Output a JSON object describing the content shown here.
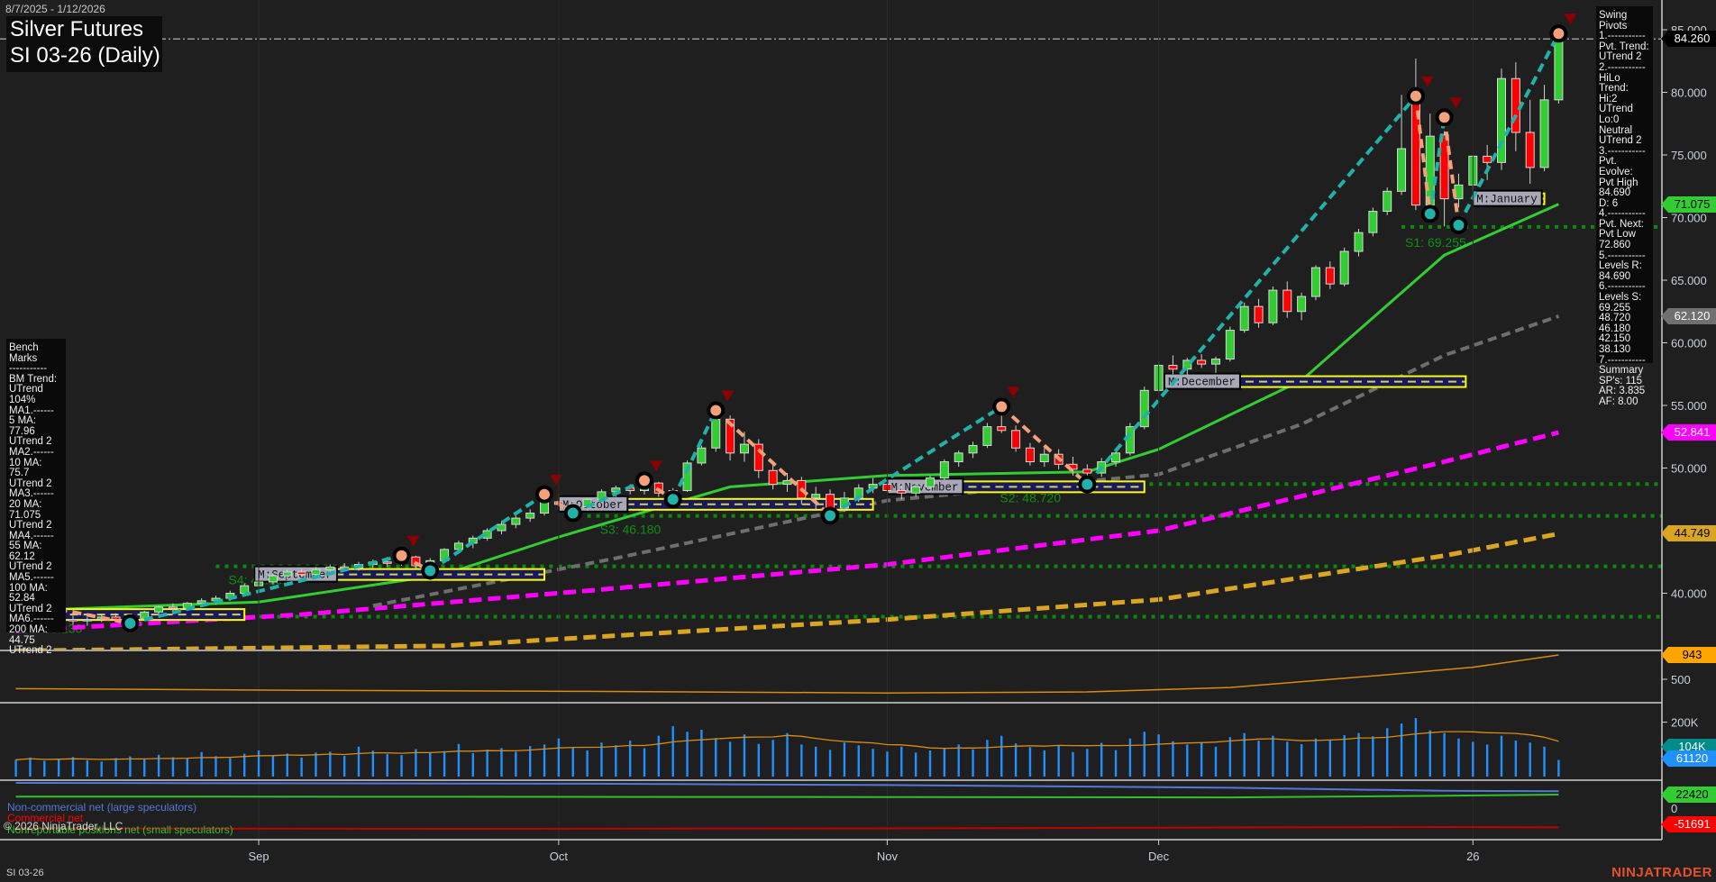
{
  "header": {
    "date_range": "8/7/2025 - 1/12/2026",
    "title_line1": "Silver Futures",
    "title_line2": "SI 03-26 (Daily)"
  },
  "swing_pivots": {
    "lines": [
      "Swing Pivots",
      "1.-----------",
      "Pvt. Trend:",
      "UTrend 2",
      "2.-----------",
      "HiLo Trend:",
      "Hi:2 UTrend",
      "Lo:0 Neutral",
      "UTrend 2",
      "3.-----------",
      "Pvt. Evolve:",
      "Pvt High",
      "84.690",
      "D: 6",
      "4.-----------",
      "Pvt. Next:",
      "Pvt Low",
      "72.860",
      "5.-----------",
      "Levels R:",
      "84.690",
      "6.-----------",
      "Levels S:",
      "69.255",
      "48.720",
      "46.180",
      "42.150",
      "38.130",
      "7.-----------",
      "Summary",
      "SP's: 115",
      "AR: 3.835",
      "AF: 8.00"
    ]
  },
  "bench_marks": {
    "lines": [
      "Bench Marks",
      "-----------",
      "BM Trend:",
      "UTrend 104%",
      "MA1.------",
      "5 MA:",
      "77.96",
      "UTrend 2",
      "MA2.------",
      "10 MA:",
      "75.7",
      "UTrend 2",
      "MA3.------",
      "20 MA:",
      "71.075",
      "UTrend 2",
      "MA4.------",
      "55 MA:",
      "62.12",
      "UTrend 2",
      "MA5.------",
      "100 MA:",
      "52.84",
      "UTrend 2",
      "MA6.------",
      "200 MA:",
      "44.75",
      "UTrend 2"
    ]
  },
  "legend": {
    "noncommercial": "Non-commercial net (large speculators)",
    "commercial": "Commercial net",
    "copyright": "© 2026 NinjaTrader, LLC",
    "nonreportable": "Nonreportable positions net (small speculators)"
  },
  "footer": {
    "symbol": "SI 03-26",
    "brand": "NINJATRADER"
  },
  "price_tags": [
    {
      "label": "84.260",
      "value": 84.26,
      "bg": "#000000",
      "fg": "#ffffff"
    },
    {
      "label": "71.075",
      "value": 71.075,
      "bg": "#32cd32",
      "fg": "#000000"
    },
    {
      "label": "62.120",
      "value": 62.12,
      "bg": "#707070",
      "fg": "#ffffff"
    },
    {
      "label": "52.841",
      "value": 52.841,
      "bg": "#ff00ff",
      "fg": "#ffffff"
    },
    {
      "label": "44.749",
      "value": 44.749,
      "bg": "#daa520",
      "fg": "#000000"
    }
  ],
  "colors": {
    "up": "#32cd32",
    "down": "#ff0000",
    "swing_up": "#20b2aa",
    "swing_down": "#f4a07a",
    "level": "#0a8a0a",
    "bg": "#1f1f1f"
  },
  "chart_data": {
    "type": "candlestick",
    "title": "Silver Futures SI 03-26 (Daily)",
    "ylim": [
      35.6,
      87.4
    ],
    "y_ticks": [
      "85.000",
      "80.000",
      "75.000",
      "70.000",
      "65.000",
      "60.000",
      "55.000",
      "50.000",
      "40.000"
    ],
    "x_ticks": [
      {
        "label": "Sep",
        "bar": 17
      },
      {
        "label": "Oct",
        "bar": 38
      },
      {
        "label": "Nov",
        "bar": 61
      },
      {
        "label": "Dec",
        "bar": 80
      },
      {
        "label": "26",
        "bar": 102
      }
    ],
    "ohlc": [
      [
        37.8,
        38.4,
        37.5,
        38.2
      ],
      [
        38.2,
        38.6,
        37.9,
        38.3
      ],
      [
        38.3,
        38.5,
        37.8,
        38.0
      ],
      [
        38.0,
        38.3,
        37.6,
        37.9
      ],
      [
        37.9,
        38.2,
        37.5,
        37.8
      ],
      [
        37.8,
        38.1,
        37.4,
        37.9
      ],
      [
        37.9,
        38.3,
        37.7,
        38.1
      ],
      [
        38.1,
        38.4,
        37.8,
        37.9
      ],
      [
        37.9,
        38.2,
        37.6,
        38.0
      ],
      [
        38.0,
        38.6,
        37.9,
        38.5
      ],
      [
        38.5,
        39.0,
        38.3,
        38.9
      ],
      [
        38.9,
        39.2,
        38.6,
        38.8
      ],
      [
        38.8,
        39.3,
        38.7,
        39.2
      ],
      [
        39.2,
        39.6,
        39.0,
        39.4
      ],
      [
        39.4,
        39.8,
        39.1,
        39.6
      ],
      [
        39.6,
        40.2,
        39.4,
        40.0
      ],
      [
        40.0,
        40.8,
        39.8,
        40.6
      ],
      [
        40.6,
        41.0,
        40.3,
        40.9
      ],
      [
        40.9,
        41.6,
        40.7,
        41.4
      ],
      [
        41.4,
        41.9,
        41.1,
        41.7
      ],
      [
        41.7,
        42.0,
        41.3,
        41.5
      ],
      [
        41.5,
        42.1,
        41.3,
        41.9
      ],
      [
        41.9,
        42.3,
        41.6,
        42.1
      ],
      [
        42.1,
        42.4,
        41.8,
        42.0
      ],
      [
        42.0,
        42.5,
        41.8,
        42.3
      ],
      [
        42.3,
        42.7,
        42.0,
        42.5
      ],
      [
        42.5,
        42.9,
        42.1,
        42.4
      ],
      [
        42.4,
        43.1,
        42.2,
        42.9
      ],
      [
        42.9,
        43.0,
        41.9,
        42.2
      ],
      [
        42.2,
        42.8,
        41.8,
        42.6
      ],
      [
        42.6,
        43.6,
        42.5,
        43.5
      ],
      [
        43.5,
        44.2,
        43.3,
        44.0
      ],
      [
        44.0,
        44.6,
        43.6,
        44.4
      ],
      [
        44.4,
        45.2,
        44.2,
        45.0
      ],
      [
        45.0,
        45.8,
        44.7,
        45.5
      ],
      [
        45.5,
        46.2,
        45.2,
        46.0
      ],
      [
        46.0,
        46.7,
        45.7,
        46.4
      ],
      [
        46.4,
        47.7,
        46.2,
        47.3
      ],
      [
        47.3,
        47.9,
        46.9,
        47.1
      ],
      [
        47.1,
        47.4,
        46.4,
        46.9
      ],
      [
        46.9,
        47.6,
        46.6,
        47.5
      ],
      [
        47.5,
        48.3,
        47.2,
        48.1
      ],
      [
        48.1,
        48.6,
        47.7,
        48.4
      ],
      [
        48.4,
        48.7,
        47.9,
        48.2
      ],
      [
        48.2,
        49.0,
        47.9,
        48.8
      ],
      [
        48.8,
        48.9,
        47.7,
        48.0
      ],
      [
        48.0,
        48.4,
        47.5,
        48.2
      ],
      [
        48.2,
        50.6,
        48.1,
        50.4
      ],
      [
        50.4,
        51.8,
        50.2,
        51.6
      ],
      [
        51.6,
        54.6,
        51.3,
        53.9
      ],
      [
        53.9,
        54.2,
        50.6,
        51.2
      ],
      [
        51.2,
        52.9,
        50.5,
        51.9
      ],
      [
        51.9,
        52.3,
        49.2,
        49.8
      ],
      [
        49.8,
        50.5,
        48.3,
        48.7
      ],
      [
        48.7,
        49.6,
        48.1,
        49.0
      ],
      [
        49.0,
        49.3,
        47.1,
        47.6
      ],
      [
        47.6,
        48.5,
        46.6,
        47.9
      ],
      [
        47.9,
        48.3,
        46.2,
        46.8
      ],
      [
        46.8,
        48.1,
        46.5,
        47.6
      ],
      [
        47.6,
        48.7,
        47.3,
        48.4
      ],
      [
        48.4,
        49.2,
        48.0,
        48.7
      ],
      [
        48.7,
        49.0,
        47.9,
        48.2
      ],
      [
        48.2,
        48.6,
        47.5,
        48.0
      ],
      [
        48.0,
        48.7,
        47.7,
        48.5
      ],
      [
        48.5,
        49.4,
        48.3,
        49.2
      ],
      [
        49.2,
        50.7,
        49.0,
        50.5
      ],
      [
        50.5,
        51.4,
        50.1,
        51.2
      ],
      [
        51.2,
        52.1,
        50.8,
        51.8
      ],
      [
        51.8,
        53.6,
        51.6,
        53.3
      ],
      [
        53.3,
        54.9,
        52.8,
        53.0
      ],
      [
        53.0,
        53.4,
        51.3,
        51.6
      ],
      [
        51.6,
        52.0,
        50.2,
        50.5
      ],
      [
        50.5,
        51.6,
        50.1,
        51.1
      ],
      [
        51.1,
        51.5,
        49.9,
        50.3
      ],
      [
        50.3,
        50.9,
        49.4,
        49.9
      ],
      [
        49.9,
        50.3,
        48.7,
        49.6
      ],
      [
        49.6,
        50.8,
        49.3,
        50.5
      ],
      [
        50.5,
        51.4,
        50.1,
        51.2
      ],
      [
        51.2,
        53.6,
        51.0,
        53.3
      ],
      [
        53.3,
        56.5,
        53.1,
        56.2
      ],
      [
        56.2,
        58.5,
        56.0,
        58.2
      ],
      [
        58.2,
        59.0,
        57.5,
        57.9
      ],
      [
        57.9,
        58.8,
        57.4,
        58.6
      ],
      [
        58.6,
        59.1,
        58.0,
        58.3
      ],
      [
        58.3,
        58.9,
        57.6,
        58.7
      ],
      [
        58.7,
        61.3,
        58.5,
        61.0
      ],
      [
        61.0,
        63.2,
        60.8,
        62.9
      ],
      [
        62.9,
        63.5,
        61.2,
        61.6
      ],
      [
        61.6,
        64.5,
        61.4,
        64.2
      ],
      [
        64.2,
        64.9,
        62.0,
        62.5
      ],
      [
        62.5,
        64.0,
        61.8,
        63.7
      ],
      [
        63.7,
        66.2,
        63.4,
        66.0
      ],
      [
        66.0,
        66.5,
        64.3,
        64.7
      ],
      [
        64.7,
        67.6,
        64.5,
        67.3
      ],
      [
        67.3,
        69.1,
        66.9,
        68.8
      ],
      [
        68.8,
        70.8,
        68.5,
        70.5
      ],
      [
        70.5,
        72.4,
        70.2,
        72.1
      ],
      [
        72.1,
        79.8,
        71.8,
        75.5
      ],
      [
        79.5,
        82.7,
        70.6,
        71.0
      ],
      [
        71.0,
        78.3,
        70.6,
        76.5
      ],
      [
        76.6,
        76.9,
        69.3,
        71.5
      ],
      [
        71.5,
        73.5,
        70.8,
        72.6
      ],
      [
        72.6,
        75.0,
        72.0,
        74.9
      ],
      [
        74.9,
        75.8,
        73.0,
        74.4
      ],
      [
        74.4,
        81.9,
        73.8,
        81.1
      ],
      [
        81.1,
        82.4,
        75.3,
        76.8
      ],
      [
        76.8,
        79.4,
        72.7,
        74.0
      ],
      [
        74.0,
        80.6,
        73.7,
        79.4
      ],
      [
        79.4,
        84.7,
        79.1,
        84.26
      ]
    ],
    "moving_averages": [
      {
        "name": "20 MA",
        "color": "#32cd32",
        "points": [
          [
            0,
            38.6
          ],
          [
            17,
            39.3
          ],
          [
            30,
            41.5
          ],
          [
            38,
            44.5
          ],
          [
            50,
            48.5
          ],
          [
            61,
            49.4
          ],
          [
            75,
            49.7
          ],
          [
            80,
            51.5
          ],
          [
            90,
            57.0
          ],
          [
            100,
            67.0
          ],
          [
            108,
            71.075
          ]
        ]
      },
      {
        "name": "55 MA",
        "color": "#6e6e6e",
        "points": [
          [
            25,
            39.0
          ],
          [
            42,
            42.8
          ],
          [
            61,
            47.4
          ],
          [
            80,
            49.5
          ],
          [
            90,
            53.5
          ],
          [
            100,
            59.0
          ],
          [
            108,
            62.12
          ]
        ]
      },
      {
        "name": "100 MA",
        "color": "#ff00ff",
        "points": [
          [
            0,
            37.0
          ],
          [
            20,
            38.3
          ],
          [
            40,
            40.2
          ],
          [
            61,
            42.3
          ],
          [
            80,
            45.0
          ],
          [
            100,
            50.5
          ],
          [
            108,
            52.841
          ]
        ]
      },
      {
        "name": "200 MA",
        "color": "#daa520",
        "points": [
          [
            0,
            35.4
          ],
          [
            30,
            35.8
          ],
          [
            61,
            37.9
          ],
          [
            80,
            39.5
          ],
          [
            100,
            43.0
          ],
          [
            108,
            44.749
          ]
        ]
      }
    ],
    "pivots": [
      [
        0,
        39.4,
        "H"
      ],
      [
        8,
        37.6,
        "L"
      ],
      [
        27,
        43.0,
        "H"
      ],
      [
        29,
        41.8,
        "L"
      ],
      [
        37,
        47.9,
        "H"
      ],
      [
        39,
        46.4,
        "L"
      ],
      [
        44,
        49.0,
        "H"
      ],
      [
        46,
        47.5,
        "L"
      ],
      [
        49,
        54.6,
        "H"
      ],
      [
        57,
        46.2,
        "L"
      ],
      [
        69,
        54.9,
        "H"
      ],
      [
        75,
        48.7,
        "L"
      ],
      [
        98,
        79.7,
        "H"
      ],
      [
        99,
        70.3,
        "L"
      ],
      [
        100,
        78.0,
        "H"
      ],
      [
        101,
        69.4,
        "L"
      ],
      [
        108,
        84.69,
        "H"
      ]
    ],
    "support_levels": [
      {
        "label": "S1: 69.255",
        "value": 69.255,
        "from": 97
      },
      {
        "label": "S2: 48.720",
        "value": 48.72,
        "from": 68
      },
      {
        "label": "S3: 46.180",
        "value": 46.18,
        "from": 40
      },
      {
        "label": "S4: 42.150",
        "value": 42.15,
        "from": 14
      },
      {
        "label": "S5: 38.130",
        "value": 38.13,
        "from": 0
      }
    ],
    "last_price": 84.26,
    "monthly_boxes": [
      {
        "label": "",
        "value": 38.3,
        "from": 0,
        "to": 16
      },
      {
        "label": "M:September",
        "value": 41.5,
        "from": 16.7,
        "to": 37
      },
      {
        "label": "M:October",
        "value": 47.1,
        "from": 38,
        "to": 60
      },
      {
        "label": "M:November",
        "value": 48.5,
        "from": 61,
        "to": 79
      },
      {
        "label": "M:December",
        "value": 56.9,
        "from": 80.4,
        "to": 101.5
      },
      {
        "label": "M:January",
        "value": 71.5,
        "from": 102,
        "to": 107
      }
    ],
    "indicator_panel": {
      "tag": "943",
      "tick": "500",
      "points": [
        [
          0,
          330
        ],
        [
          20,
          300
        ],
        [
          40,
          280
        ],
        [
          61,
          250
        ],
        [
          75,
          270
        ],
        [
          85,
          350
        ],
        [
          95,
          560
        ],
        [
          102,
          720
        ],
        [
          108,
          943
        ]
      ]
    },
    "volume_panel": {
      "tick": "200K",
      "tags": [
        "104K",
        "61120"
      ],
      "volume_k": [
        62,
        70,
        58,
        66,
        72,
        60,
        55,
        68,
        74,
        63,
        80,
        71,
        66,
        90,
        75,
        68,
        84,
        96,
        78,
        85,
        70,
        88,
        92,
        76,
        110,
        95,
        83,
        79,
        101,
        88,
        94,
        120,
        86,
        99,
        105,
        91,
        112,
        118,
        140,
        108,
        96,
        125,
        115,
        132,
        104,
        150,
        185,
        165,
        172,
        142,
        128,
        155,
        120,
        135,
        160,
        118,
        110,
        98,
        125,
        115,
        102,
        92,
        110,
        88,
        96,
        105,
        118,
        100,
        135,
        150,
        122,
        108,
        96,
        115,
        90,
        102,
        124,
        97,
        140,
        165,
        155,
        130,
        118,
        126,
        110,
        145,
        160,
        132,
        150,
        128,
        119,
        140,
        135,
        152,
        160,
        148,
        178,
        195,
        215,
        170,
        160,
        140,
        128,
        118,
        150,
        132,
        125,
        110,
        61.12
      ]
    },
    "cot_panel": {
      "tick": "0",
      "tags": [
        "22420",
        "-51691"
      ],
      "noncommercial": [
        [
          0,
          49000
        ],
        [
          40,
          47000
        ],
        [
          61,
          44000
        ],
        [
          85,
          38000
        ],
        [
          100,
          31000
        ],
        [
          108,
          30000
        ]
      ],
      "nonreportable": [
        [
          0,
          18000
        ],
        [
          30,
          17500
        ],
        [
          61,
          17000
        ],
        [
          85,
          16000
        ],
        [
          100,
          20000
        ],
        [
          108,
          22420
        ]
      ],
      "commercial": [
        [
          0,
          -54000
        ],
        [
          30,
          -55000
        ],
        [
          61,
          -54000
        ],
        [
          85,
          -52000
        ],
        [
          100,
          -51000
        ],
        [
          108,
          -51691
        ]
      ]
    }
  }
}
